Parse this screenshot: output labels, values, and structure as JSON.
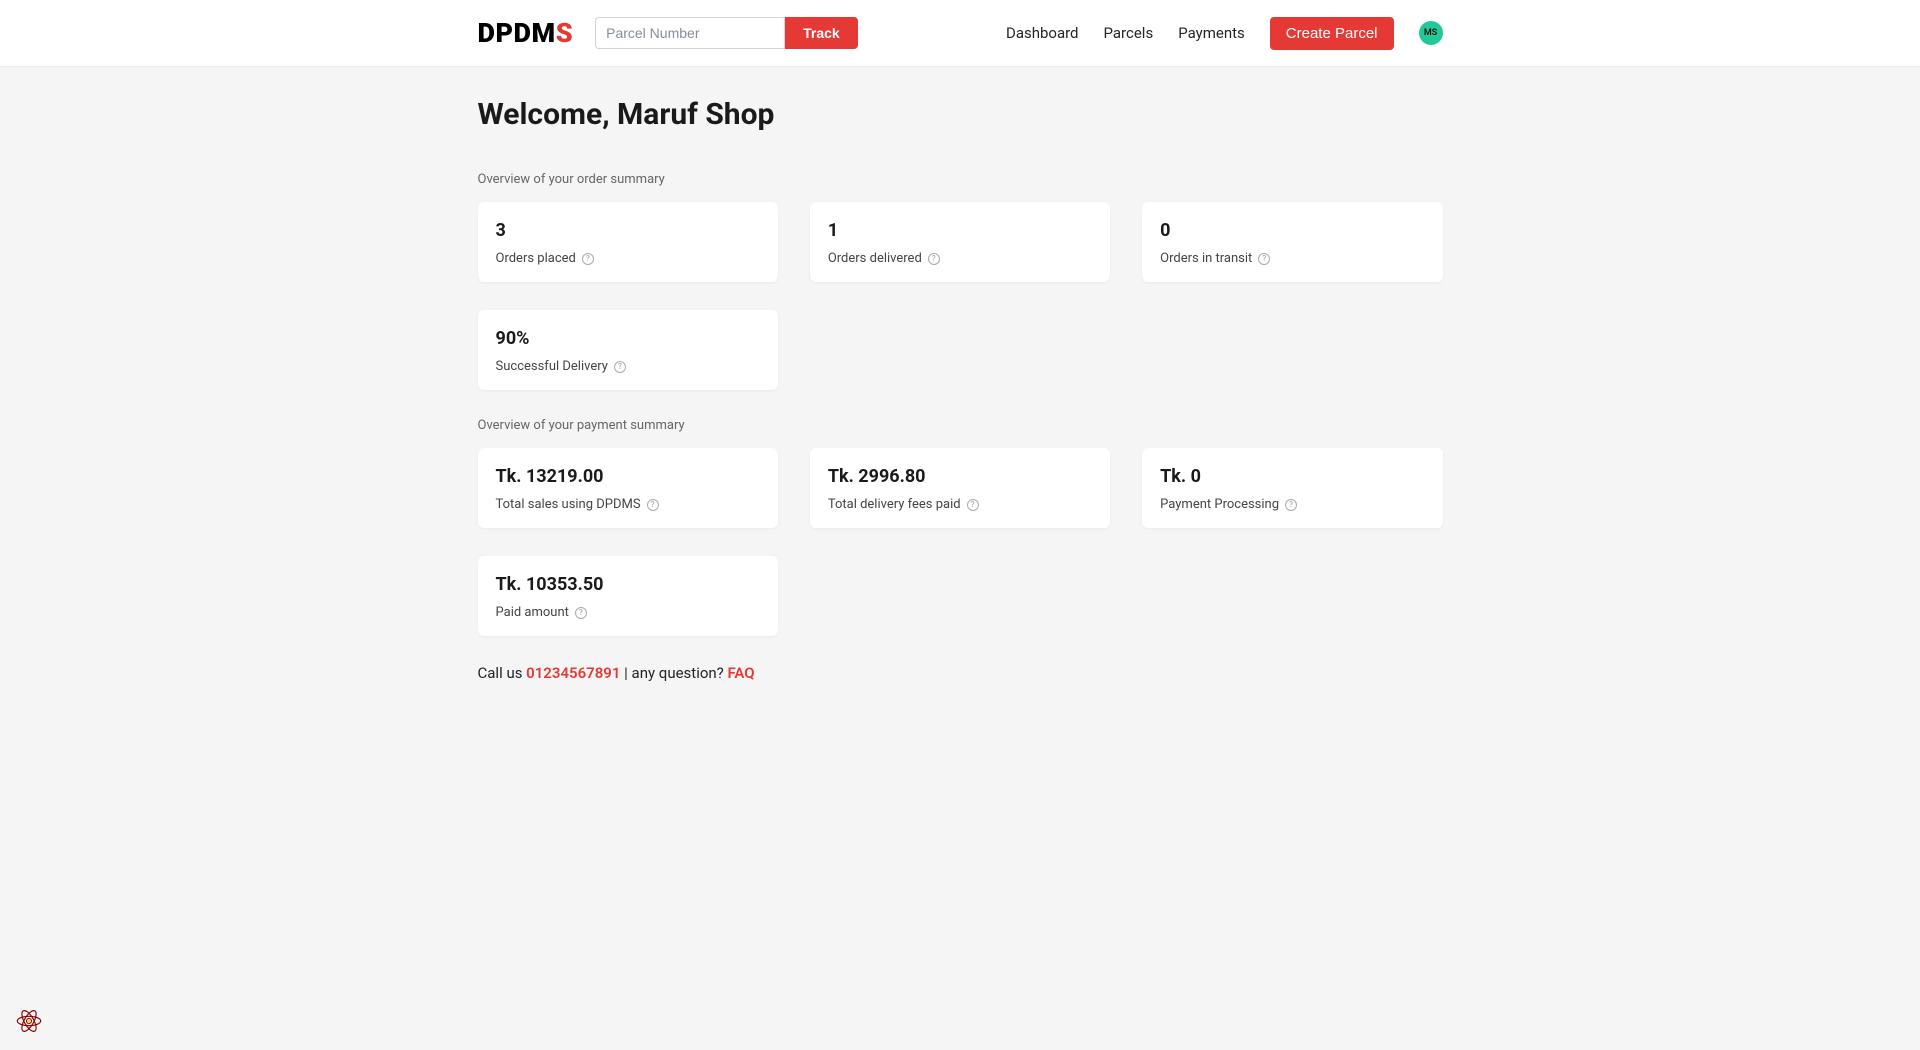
{
  "header": {
    "logo_main": "DPDM",
    "logo_s": "S",
    "search_placeholder": "Parcel Number",
    "track_label": "Track",
    "nav": {
      "dashboard": "Dashboard",
      "parcels": "Parcels",
      "payments": "Payments",
      "create_parcel": "Create Parcel"
    },
    "avatar_initials": "MS"
  },
  "main": {
    "welcome": "Welcome, Maruf Shop",
    "order_summary_title": "Overview of your order summary",
    "order_cards": [
      {
        "value": "3",
        "label": "Orders placed"
      },
      {
        "value": "1",
        "label": "Orders delivered"
      },
      {
        "value": "0",
        "label": "Orders in transit"
      },
      {
        "value": "90%",
        "label": "Successful Delivery"
      }
    ],
    "payment_summary_title": "Overview of your payment summary",
    "payment_cards": [
      {
        "value": "Tk. 13219.00",
        "label": "Total sales using DPDMS"
      },
      {
        "value": "Tk. 2996.80",
        "label": "Total delivery fees paid"
      },
      {
        "value": "Tk. 0",
        "label": "Payment Processing"
      },
      {
        "value": "Tk. 10353.50",
        "label": "Paid amount"
      }
    ]
  },
  "footer": {
    "call_us": "Call us ",
    "phone": "01234567891",
    "mid": " | any question? ",
    "faq": "FAQ"
  }
}
